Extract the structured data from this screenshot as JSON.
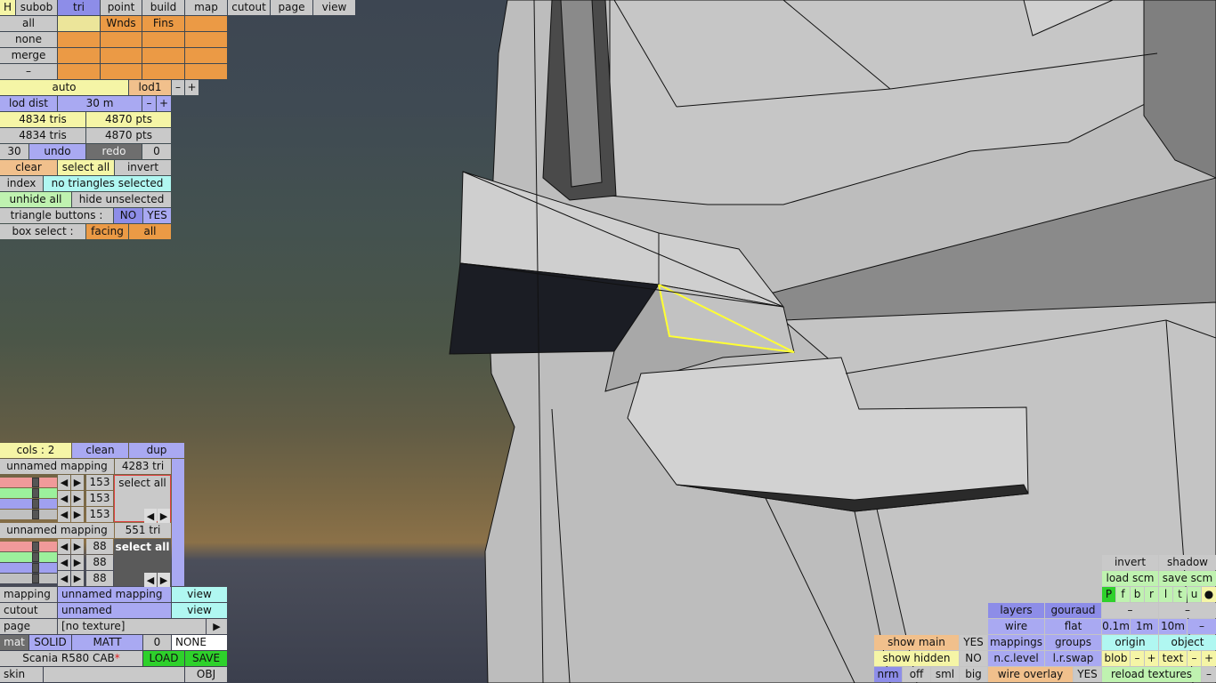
{
  "tabs": {
    "h": "H",
    "subob": "subob",
    "tri": "tri",
    "point": "point",
    "build": "build",
    "map": "map",
    "cutout": "cutout",
    "page": "page",
    "view": "view"
  },
  "groups": {
    "all": "all",
    "none": "none",
    "merge": "merge",
    "dash": "–",
    "col1": "Wnds",
    "col2": "Fins"
  },
  "lod": {
    "auto": "auto",
    "level": "lod1",
    "minus": "–",
    "plus": "+",
    "dist_label": "lod dist",
    "dist": "30 m"
  },
  "stats": {
    "tris1": "4834 tris",
    "pts1": "4870 pts",
    "tris2": "4834 tris",
    "pts2": "4870 pts"
  },
  "undo": {
    "count": "30",
    "undo": "undo",
    "redo": "redo",
    "redo_count": "0"
  },
  "select": {
    "clear": "clear",
    "select_all": "select all",
    "invert": "invert",
    "index": "index",
    "status": "no triangles selected",
    "unhide_all": "unhide all",
    "hide_unselected": "hide unselected"
  },
  "triangle_buttons": {
    "label": "triangle buttons :",
    "no": "NO",
    "yes": "YES"
  },
  "box_select": {
    "label": "box select :",
    "facing": "facing",
    "all": "all"
  },
  "cols": {
    "label": "cols : 2",
    "clean": "clean",
    "dup": "dup"
  },
  "mapping1": {
    "name": "unnamed mapping",
    "tris": "4283 tri",
    "v1": "153",
    "v2": "153",
    "v3": "153",
    "select_all": "select all"
  },
  "mapping2": {
    "name": "unnamed mapping",
    "tris": "551 tri",
    "v1": "88",
    "v2": "88",
    "v3": "88",
    "select_all": "select all"
  },
  "lower": {
    "mapping_label": "mapping",
    "mapping_value": "unnamed mapping",
    "mapping_view": "view",
    "cutout_label": "cutout",
    "cutout_value": "unnamed",
    "cutout_view": "view",
    "page_label": "page",
    "page_value": "[no texture]",
    "mat": "mat",
    "solid": "SOLID",
    "matt": "MATT",
    "mat_num": "0",
    "mat_none": "NONE",
    "model_name": "Scania R580 CAB",
    "modified_mark": "*",
    "load": "LOAD",
    "save": "SAVE",
    "skin": "skin",
    "obj": "OBJ"
  },
  "view_panel": {
    "invert": "invert",
    "shadow": "shadow",
    "load_scm": "load scm",
    "save_scm": "save scm",
    "flags": [
      "P",
      "f",
      "b",
      "r",
      "l",
      "t",
      "u",
      "●"
    ],
    "dash1": "–",
    "dash2": "–",
    "layers": "layers",
    "gouraud": "gouraud",
    "wire": "wire",
    "flat": "flat",
    "d01": "0.1m",
    "d1": "1m",
    "d10": "10m",
    "dminus": "–",
    "show_main": "show main",
    "show_main_val": "YES",
    "mappings": "mappings",
    "groups": "groups",
    "origin": "origin",
    "object": "object",
    "show_hidden": "show hidden",
    "show_hidden_val": "NO",
    "nclevel": "n.c.level",
    "lrswap": "l.r.swap",
    "blob": "blob",
    "blob_minus": "–",
    "blob_plus": "+",
    "text": "text",
    "text_minus": "–",
    "text_plus": "+",
    "nrm": "nrm",
    "off": "off",
    "sml": "sml",
    "big": "big",
    "wire_overlay": "wire overlay",
    "wire_overlay_val": "YES",
    "reload_textures": "reload textures",
    "reload_minus": "–"
  },
  "colors": {
    "blue": "#a9a9f2",
    "yellow": "#f5f5a6",
    "orange": "#eb9a45",
    "teal": "#b0f7f1",
    "green": "#bff2b0",
    "selection": "#ffff33"
  }
}
